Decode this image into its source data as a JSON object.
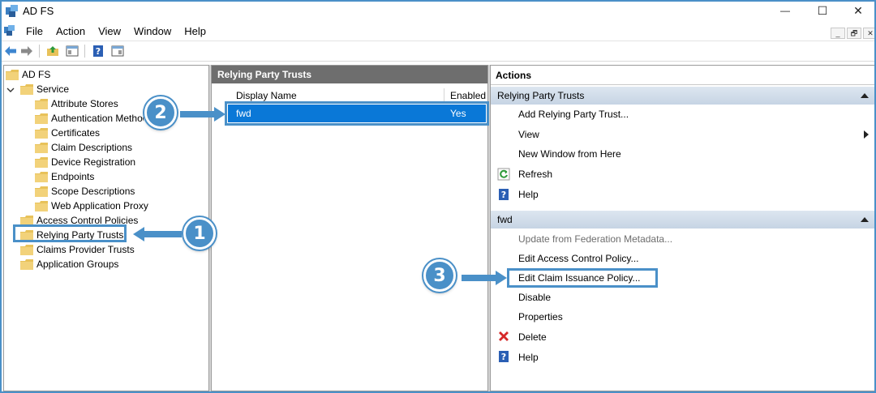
{
  "window": {
    "title": "AD FS",
    "minimize_glyph": "—",
    "maximize_glyph": "☐",
    "close_glyph": "✕"
  },
  "menu": {
    "items": [
      "File",
      "Action",
      "View",
      "Window",
      "Help"
    ],
    "mdi_minimize": "_",
    "mdi_restore": "🗗",
    "mdi_close": "✕"
  },
  "tree": {
    "root": "AD FS",
    "service": "Service",
    "service_children": [
      "Attribute Stores",
      "Authentication Methods",
      "Certificates",
      "Claim Descriptions",
      "Device Registration",
      "Endpoints",
      "Scope Descriptions",
      "Web Application Proxy"
    ],
    "top_items": [
      "Access Control Policies",
      "Relying Party Trusts",
      "Claims Provider Trusts",
      "Application Groups"
    ]
  },
  "middle": {
    "header": "Relying Party Trusts",
    "columns": [
      "Display Name",
      "Enabled"
    ],
    "rows": [
      {
        "display_name": "fwd",
        "enabled": "Yes"
      }
    ]
  },
  "actions": {
    "title": "Actions",
    "section1": {
      "label": "Relying Party Trusts",
      "items": [
        "Add Relying Party Trust...",
        "View",
        "New Window from Here",
        "Refresh",
        "Help"
      ]
    },
    "section2": {
      "label": "fwd",
      "items": [
        "Update from Federation Metadata...",
        "Edit Access Control Policy...",
        "Edit Claim Issuance Policy...",
        "Disable",
        "Properties",
        "Delete",
        "Help"
      ]
    }
  },
  "callouts": [
    "1",
    "2",
    "3"
  ],
  "colors": {
    "accent": "#4a90c8",
    "selection": "#0a78d7",
    "header_dark": "#6e6e6e",
    "folder": "#e8c25a"
  }
}
